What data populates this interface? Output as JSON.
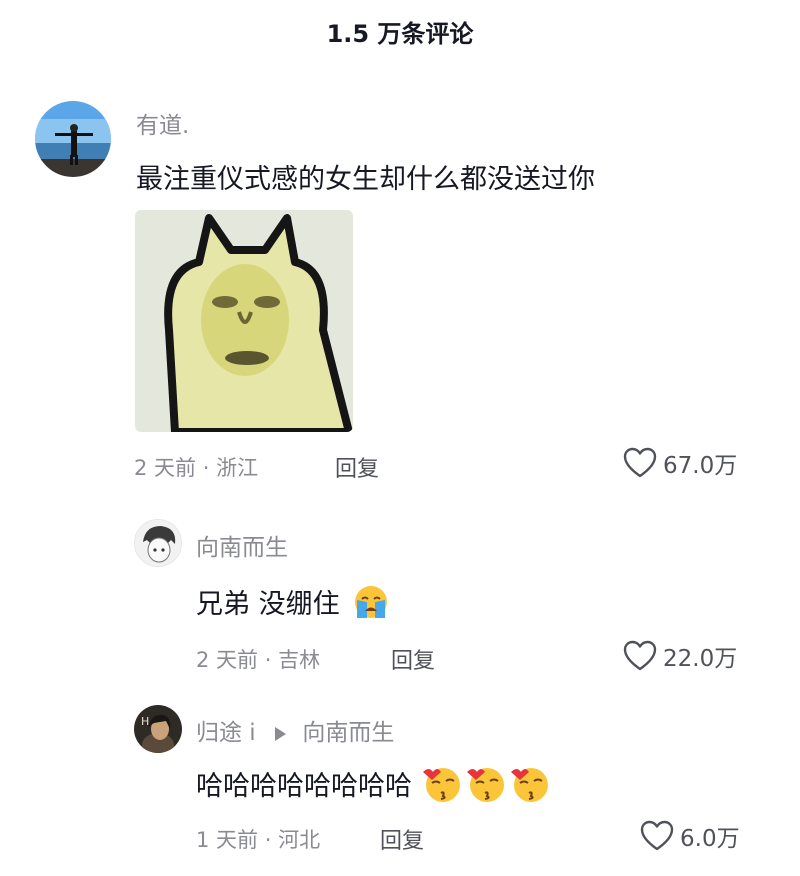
{
  "header": {
    "title": "1.5 万条评论"
  },
  "comments": [
    {
      "username": "有道.",
      "text": "最注重仪式感的女生却什么都没送过你",
      "time": "2 天前",
      "location": "浙江",
      "reply_label": "回复",
      "likes": "67.0万"
    },
    {
      "username": "向南而生",
      "text": "兄弟 没绷住",
      "time": "2 天前",
      "location": "吉林",
      "reply_label": "回复",
      "likes": "22.0万"
    },
    {
      "username": "归途 i",
      "reply_to": "向南而生",
      "text": "哈哈哈哈哈哈哈哈",
      "time": "1 天前",
      "location": "河北",
      "reply_label": "回复",
      "likes": "6.0万"
    }
  ],
  "meta_separator": " · ",
  "icons": {
    "like": "heart-outline-icon",
    "reply_arrow": "triangle-right-icon",
    "crying": "loudly-crying-face-emoji",
    "kiss": "face-blowing-kiss-emoji"
  },
  "colors": {
    "primary_text": "#161823",
    "secondary_text": "#8a8b91",
    "action_text": "#505259"
  }
}
